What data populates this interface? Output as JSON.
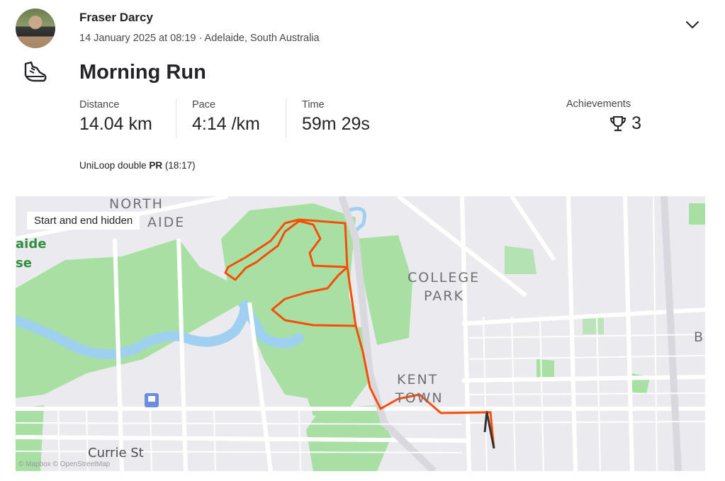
{
  "header": {
    "athlete_name": "Fraser Darcy",
    "meta": "14 January 2025 at 08:19 · Adelaide, South Australia",
    "avatar_icon": "athlete-photo",
    "menu_icon": "chevron-down-icon"
  },
  "activity": {
    "sport_icon": "running-shoe-icon",
    "title": "Morning Run"
  },
  "stats": [
    {
      "label": "Distance",
      "value": "14.04 km"
    },
    {
      "label": "Pace",
      "value": "4:14 /km"
    },
    {
      "label": "Time",
      "value": "59m 29s"
    }
  ],
  "achievements": {
    "label": "Achievements",
    "icon": "trophy-icon",
    "count": "3"
  },
  "segment": {
    "prefix": "UniLoop double ",
    "badge": "PR",
    "suffix": " (18:17)"
  },
  "map": {
    "privacy_label": "Start and end hidden",
    "place_labels": [
      "NORTH",
      "AIDE",
      "COLLEGE",
      "PARK",
      "KENT",
      "TOWN",
      "Currie St",
      "aide",
      "se",
      "B"
    ],
    "attribution": "© Mapbox © OpenStreetMap",
    "route_color": "#fc4c02",
    "hidden_segment_color": "#333333",
    "park_color": "#a8e0a4",
    "water_color": "#9fd0f0"
  }
}
